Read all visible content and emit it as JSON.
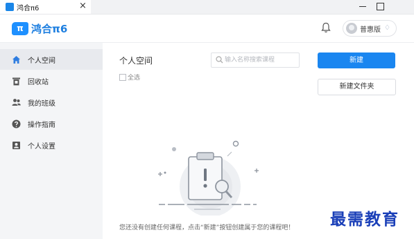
{
  "window": {
    "tab_title": "鸿合π6",
    "tab_close": "×"
  },
  "header": {
    "logo_mark": "π",
    "app_name": "鸿合π6",
    "user_name": "普惠版",
    "user_badge": "♢"
  },
  "sidebar": {
    "items": [
      {
        "label": "个人空间",
        "icon": "home-icon",
        "active": true
      },
      {
        "label": "回收站",
        "icon": "trash-icon",
        "active": false
      },
      {
        "label": "我的班级",
        "icon": "users-icon",
        "active": false
      },
      {
        "label": "操作指南",
        "icon": "help-icon",
        "active": false
      },
      {
        "label": "个人设置",
        "icon": "profile-icon",
        "active": false
      }
    ]
  },
  "main": {
    "title": "个人空间",
    "search_placeholder": "输入名称搜索课程",
    "search_value": "",
    "select_all_label": "全选",
    "new_button": "新建",
    "new_folder_button": "新建文件夹",
    "empty_message": "您还没有创建任何课程，点击“新建”按钮创建属于您的课程吧！"
  },
  "watermark": "最需教育",
  "colors": {
    "primary": "#1a86f0",
    "sidebar_bg": "#f4f5f7",
    "active_bg": "#e8eaee",
    "watermark": "#1a3fb8"
  }
}
